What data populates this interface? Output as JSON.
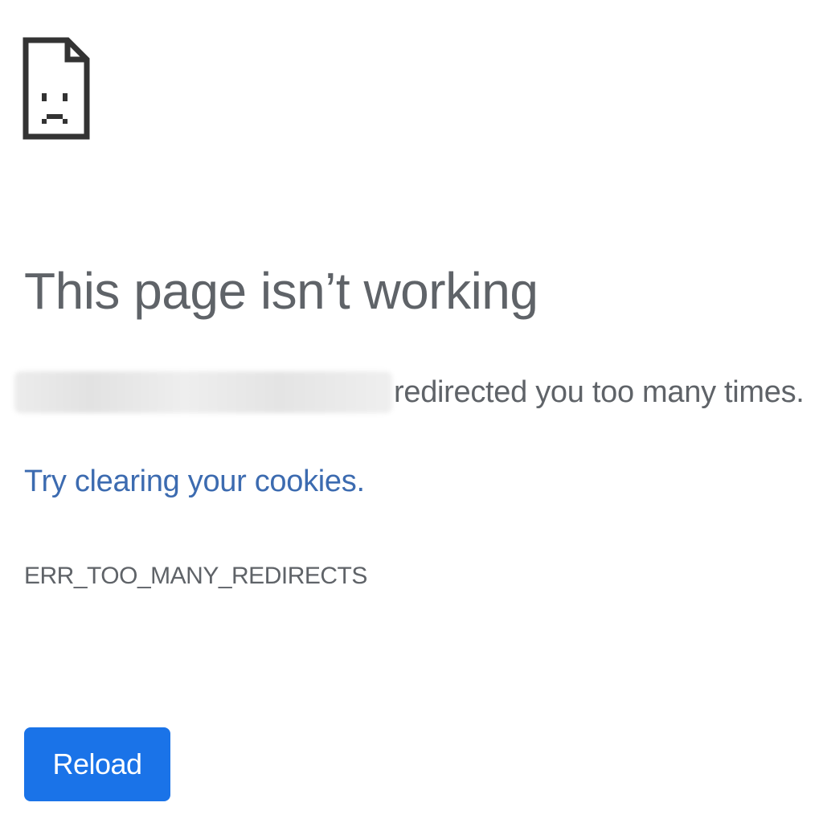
{
  "error_page": {
    "icon": "sad-page-icon",
    "title": "This page isn’t working",
    "message_suffix": "redirected you too many times.",
    "suggestion_link": "Try clearing your cookies.",
    "error_code": "ERR_TOO_MANY_REDIRECTS",
    "reload_label": "Reload"
  },
  "colors": {
    "text": "#5f6368",
    "link": "#3c6bb0",
    "button": "#1a73e8",
    "button_text": "#ffffff",
    "icon": "#333333"
  }
}
